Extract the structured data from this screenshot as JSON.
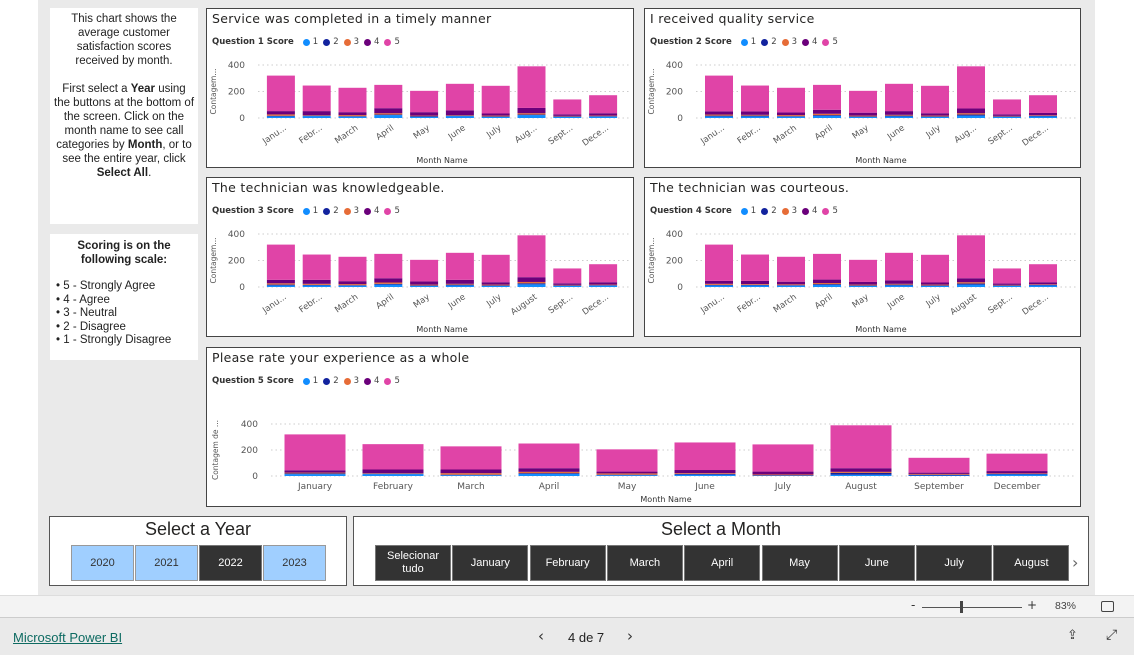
{
  "info_text": {
    "p1": "This chart shows the average customer satisfaction scores received by month.",
    "p2_pre": "First select a ",
    "year_word": "Year",
    "p2_mid": " using the buttons at the bottom of the screen. Click on the month name to see call categories by ",
    "month_word": "Month",
    "p2_mid2": ", or to see the entire year, click ",
    "select_all": "Select All",
    "p2_end": "."
  },
  "scale": {
    "title": "Scoring is on the following scale:",
    "items": [
      "5 - Strongly Agree",
      "4 - Agree",
      "3 - Neutral",
      "2 - Disagree",
      "1 - Strongly Disagree"
    ]
  },
  "colors": {
    "1": "#118dff",
    "2": "#12239e",
    "3": "#e66c37",
    "4": "#6b007b",
    "5": "#e044a7"
  },
  "chart_data": [
    {
      "type": "bar",
      "stacked": true,
      "title": "Service was completed in a timely manner",
      "legend_title": "Question 1 Score",
      "xlabel": "Month Name",
      "ylabel": "Contagem...",
      "ylim": [
        0,
        400
      ],
      "yticks": [
        0,
        200,
        400
      ],
      "grid": true,
      "categories": [
        "Janu...",
        "Febr...",
        "March",
        "April",
        "May",
        "June",
        "July",
        "Aug...",
        "Sept...",
        "Dece..."
      ],
      "series": [
        {
          "name": "1",
          "values": [
            12,
            14,
            10,
            22,
            8,
            14,
            8,
            22,
            8,
            10
          ]
        },
        {
          "name": "2",
          "values": [
            5,
            4,
            4,
            4,
            6,
            4,
            4,
            4,
            4,
            4
          ]
        },
        {
          "name": "3",
          "values": [
            10,
            4,
            8,
            10,
            4,
            4,
            6,
            10,
            4,
            4
          ]
        },
        {
          "name": "4",
          "values": [
            25,
            30,
            22,
            38,
            26,
            36,
            16,
            40,
            12,
            18
          ]
        },
        {
          "name": "5",
          "values": [
            268,
            193,
            184,
            176,
            161,
            200,
            209,
            314,
            112,
            136
          ]
        }
      ]
    },
    {
      "type": "bar",
      "stacked": true,
      "title": "I received quality service",
      "legend_title": "Question 2 Score",
      "xlabel": "Month Name",
      "ylabel": "Contagem...",
      "ylim": [
        0,
        400
      ],
      "yticks": [
        0,
        200,
        400
      ],
      "grid": true,
      "categories": [
        "Janu...",
        "Febr...",
        "March",
        "April",
        "May",
        "June",
        "July",
        "Aug...",
        "Sept...",
        "Dece..."
      ],
      "series": [
        {
          "name": "1",
          "values": [
            12,
            12,
            10,
            16,
            8,
            12,
            8,
            18,
            8,
            12
          ]
        },
        {
          "name": "2",
          "values": [
            6,
            6,
            4,
            6,
            4,
            6,
            4,
            8,
            4,
            4
          ]
        },
        {
          "name": "3",
          "values": [
            8,
            6,
            8,
            10,
            6,
            6,
            6,
            10,
            4,
            4
          ]
        },
        {
          "name": "4",
          "values": [
            24,
            26,
            20,
            30,
            22,
            28,
            18,
            36,
            12,
            18
          ]
        },
        {
          "name": "5",
          "values": [
            270,
            195,
            186,
            188,
            165,
            206,
            207,
            318,
            112,
            134
          ]
        }
      ]
    },
    {
      "type": "bar",
      "stacked": true,
      "title": "The technician was knowledgeable.",
      "legend_title": "Question 3 Score",
      "xlabel": "Month Name",
      "ylabel": "Contagem...",
      "ylim": [
        0,
        400
      ],
      "yticks": [
        0,
        200,
        400
      ],
      "grid": true,
      "categories": [
        "Janu...",
        "Febr...",
        "March",
        "April",
        "May",
        "June",
        "July",
        "August",
        "Sept...",
        "Dece..."
      ],
      "series": [
        {
          "name": "1",
          "values": [
            12,
            12,
            10,
            18,
            8,
            12,
            8,
            20,
            8,
            10
          ]
        },
        {
          "name": "2",
          "values": [
            6,
            4,
            4,
            6,
            4,
            6,
            4,
            8,
            4,
            4
          ]
        },
        {
          "name": "3",
          "values": [
            10,
            8,
            8,
            10,
            6,
            6,
            6,
            10,
            4,
            4
          ]
        },
        {
          "name": "4",
          "values": [
            26,
            30,
            22,
            32,
            24,
            30,
            18,
            36,
            12,
            18
          ]
        },
        {
          "name": "5",
          "values": [
            266,
            191,
            184,
            184,
            163,
            204,
            207,
            316,
            112,
            136
          ]
        }
      ]
    },
    {
      "type": "bar",
      "stacked": true,
      "title": "The technician was courteous.",
      "legend_title": "Question 4 Score",
      "xlabel": "Month Name",
      "ylabel": "Contagem...",
      "ylim": [
        0,
        400
      ],
      "yticks": [
        0,
        200,
        400
      ],
      "grid": true,
      "categories": [
        "Janu...",
        "Febr...",
        "March",
        "April",
        "May",
        "June",
        "July",
        "August",
        "Sept...",
        "Dece..."
      ],
      "series": [
        {
          "name": "1",
          "values": [
            12,
            12,
            10,
            16,
            8,
            12,
            8,
            18,
            8,
            12
          ]
        },
        {
          "name": "2",
          "values": [
            4,
            4,
            4,
            6,
            4,
            6,
            4,
            8,
            4,
            4
          ]
        },
        {
          "name": "3",
          "values": [
            8,
            6,
            6,
            8,
            6,
            6,
            6,
            10,
            4,
            4
          ]
        },
        {
          "name": "4",
          "values": [
            22,
            24,
            20,
            26,
            20,
            26,
            16,
            30,
            10,
            16
          ]
        },
        {
          "name": "5",
          "values": [
            274,
            199,
            188,
            194,
            167,
            208,
            209,
            324,
            114,
            136
          ]
        }
      ]
    },
    {
      "type": "bar",
      "stacked": true,
      "title": "Please rate your experience as a whole",
      "legend_title": "Question 5 Score",
      "xlabel": "Month Name",
      "ylabel": "Contagem de ...",
      "ylim": [
        0,
        400
      ],
      "yticks": [
        0,
        200,
        400
      ],
      "grid": true,
      "categories": [
        "January",
        "February",
        "March",
        "April",
        "May",
        "June",
        "July",
        "August",
        "September",
        "December"
      ],
      "series": [
        {
          "name": "1",
          "values": [
            14,
            14,
            6,
            16,
            6,
            10,
            4,
            10,
            4,
            12
          ]
        },
        {
          "name": "2",
          "values": [
            6,
            4,
            4,
            6,
            4,
            6,
            2,
            14,
            6,
            4
          ]
        },
        {
          "name": "3",
          "values": [
            6,
            4,
            12,
            10,
            10,
            6,
            6,
            8,
            6,
            4
          ]
        },
        {
          "name": "4",
          "values": [
            18,
            28,
            28,
            28,
            14,
            24,
            22,
            28,
            10,
            18
          ]
        },
        {
          "name": "5",
          "values": [
            276,
            195,
            178,
            190,
            171,
            212,
            209,
            330,
            114,
            134
          ]
        }
      ]
    }
  ],
  "year_slicer": {
    "title": "Select a Year",
    "options": [
      {
        "label": "2020",
        "selected": true
      },
      {
        "label": "2021",
        "selected": true
      },
      {
        "label": "2022",
        "selected": false
      },
      {
        "label": "2023",
        "selected": true
      }
    ]
  },
  "month_slicer": {
    "title": "Select a Month",
    "options": [
      "Selecionar tudo",
      "January",
      "February",
      "March",
      "April",
      "May",
      "June",
      "July",
      "August"
    ]
  },
  "zoom": {
    "minus": "-",
    "plus": "+",
    "level": "83%",
    "value_percent": 83
  },
  "footer": {
    "brand": "Microsoft Power BI",
    "page": "4 de 7"
  }
}
